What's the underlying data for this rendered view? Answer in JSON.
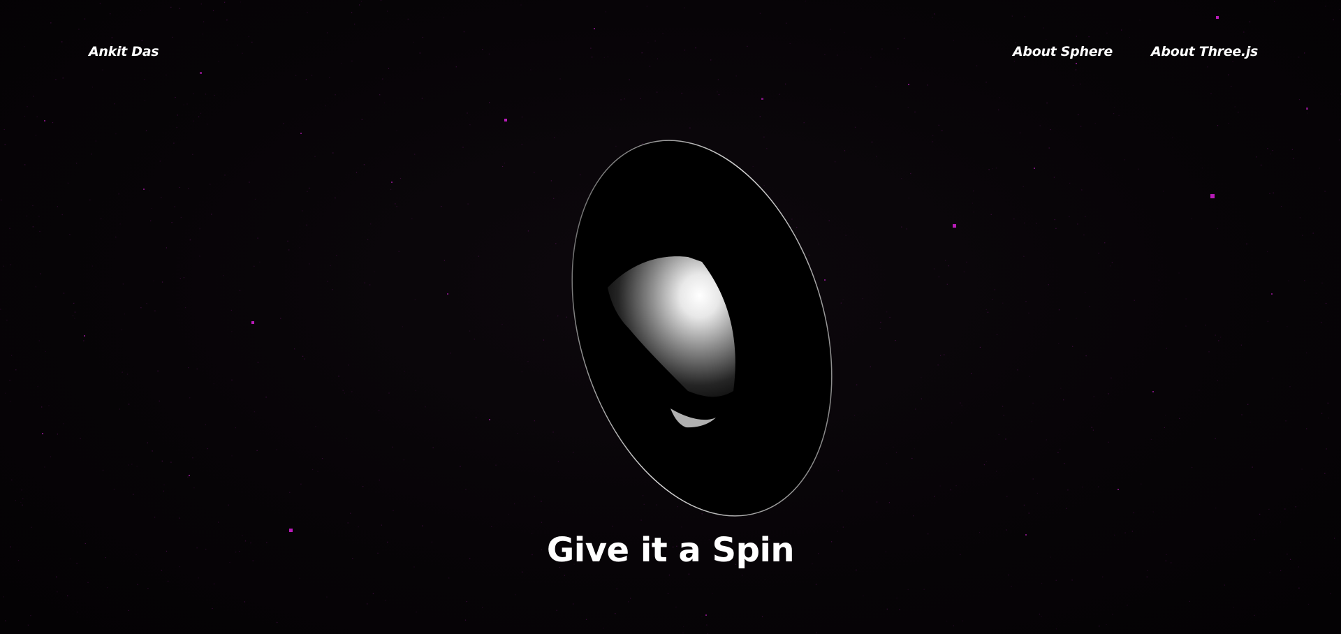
{
  "nav": {
    "brand": "Ankit Das",
    "links": [
      {
        "label": "About Sphere"
      },
      {
        "label": "About Three.js"
      }
    ]
  },
  "hero": {
    "headline": "Give it a Spin"
  },
  "colors": {
    "background": "#050305",
    "star": "#c21cc2",
    "text": "#ffffff"
  }
}
